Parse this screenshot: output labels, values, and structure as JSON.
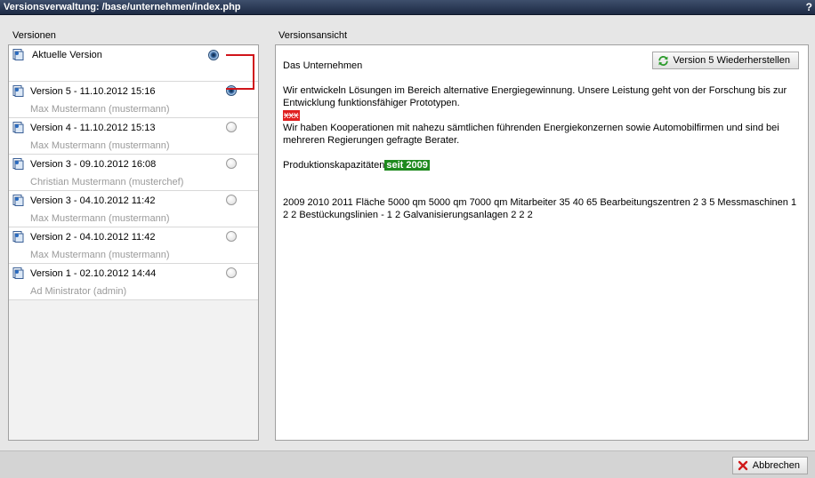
{
  "window": {
    "title": "Versionsverwaltung: /base/unternehmen/index.php",
    "help_label": "?"
  },
  "left": {
    "label": "Versionen",
    "current_label": "Aktuelle Version",
    "versions": [
      {
        "title": "Version 5 - 11.10.2012 15:16",
        "user": "Max Mustermann (mustermann)",
        "selected": true
      },
      {
        "title": "Version 4 - 11.10.2012 15:13",
        "user": "Max Mustermann (mustermann)",
        "selected": false
      },
      {
        "title": "Version 3 - 09.10.2012 16:08",
        "user": "Christian Mustermann (musterchef)",
        "selected": false
      },
      {
        "title": "Version 3 - 04.10.2012 11:42",
        "user": "Max Mustermann (mustermann)",
        "selected": false
      },
      {
        "title": "Version 2 - 04.10.2012 11:42",
        "user": "Max Mustermann (mustermann)",
        "selected": false
      },
      {
        "title": "Version 1 - 02.10.2012 14:44",
        "user": "Ad Ministrator (admin)",
        "selected": false
      }
    ]
  },
  "right": {
    "label": "Versionsansicht",
    "restore_label": "Version 5 Wiederherstellen",
    "content": {
      "heading": "Das Unternehmen",
      "para1": "Wir entwickeln Lösungen im Bereich alternative Energiegewinnung. Unsere Leistung geht von der Forschung bis zur Entwicklung funktionsfähiger Prototypen.",
      "deleted": "xxx",
      "para2": "Wir haben Kooperationen mit nahezu sämtlichen führenden Energiekonzernen sowie Automobilfirmen und sind bei mehreren Regierungen gefragte Berater.",
      "prod_label": "Produktionskapazitäten",
      "inserted": "seit 2009",
      "table_text": "2009 2010 2011 Fläche 5000 qm 5000 qm 7000 qm Mitarbeiter 35 40 65 Bearbeitungszentren 2 3 5 Messmaschinen 1 2 2 Bestückungslinien - 1 2 Galvanisierungsanlagen 2 2 2"
    }
  },
  "footer": {
    "cancel_label": "Abbrechen"
  },
  "colors": {
    "titlebar": "#2b3a57",
    "deleted_bg": "#e02020",
    "inserted_bg": "#1e8a1e",
    "connector": "#d0141a"
  }
}
